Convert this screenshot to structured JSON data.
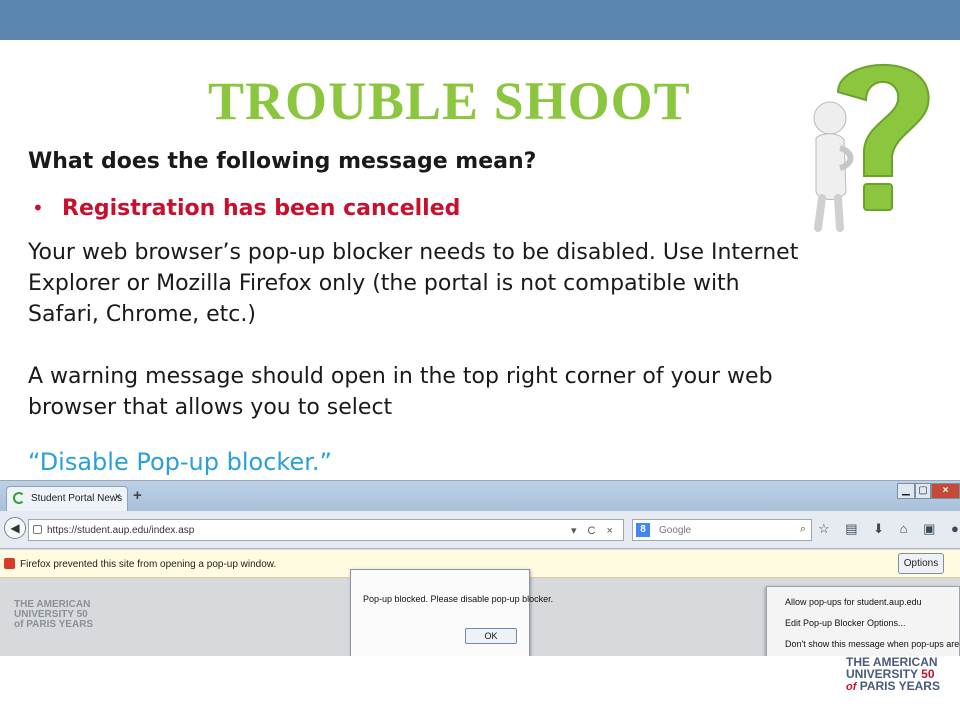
{
  "slide": {
    "title": "TROUBLE SHOOT",
    "question": "What does the following message mean?",
    "bullet": "Registration has been cancelled",
    "paragraph1": "Your web browser’s pop-up blocker needs to be disabled. Use Internet Explorer or Mozilla Firefox only (the portal is not compatible with Safari, Chrome, etc.)",
    "paragraph2": "A warning message should open in the top right corner of your web browser that allows you to select",
    "quote": "“Disable Pop-up blocker.”",
    "colors": {
      "title": "#8cc63f",
      "bullet": "#c8102e",
      "quote": "#2aa0d8",
      "topbar": "#5b86b0"
    },
    "figure_icon": "thinking-man-question-mark-icon"
  },
  "browser": {
    "tab_title": "Student Portal News",
    "tab_close": "×",
    "new_tab": "+",
    "window_controls": {
      "minimize": "▁",
      "maximize": "▢",
      "close": "×"
    },
    "url": "https://student.aup.edu/index.asp",
    "url_icons": "▾ C ×",
    "search_engine_badge": "8",
    "search_placeholder": "Google",
    "search_button": "⌕",
    "toolbar_icons": "☆ ▤ ⬇ ⌂ ▣ ● ≡",
    "notification": "Firefox prevented this site from opening a pop-up window.",
    "options_label": "Options",
    "page_logo_lines": [
      "THE AMERICAN",
      "UNIVERSITY 50",
      "of PARIS YEARS"
    ],
    "dialog": {
      "message": "Pop-up blocked. Please disable pop-up blocker.",
      "ok_label": "OK"
    },
    "menu_items": [
      "Allow pop-ups for student.aup.edu",
      "Edit Pop-up Blocker Options...",
      "Don't show this message when pop-ups are blocked"
    ]
  },
  "footer_logo": {
    "line1": "THE AMERICAN",
    "line2_text": "UNIVERSITY",
    "line2_num": "50",
    "line3_italic": "of",
    "line3_text": "PARIS YEARS"
  }
}
